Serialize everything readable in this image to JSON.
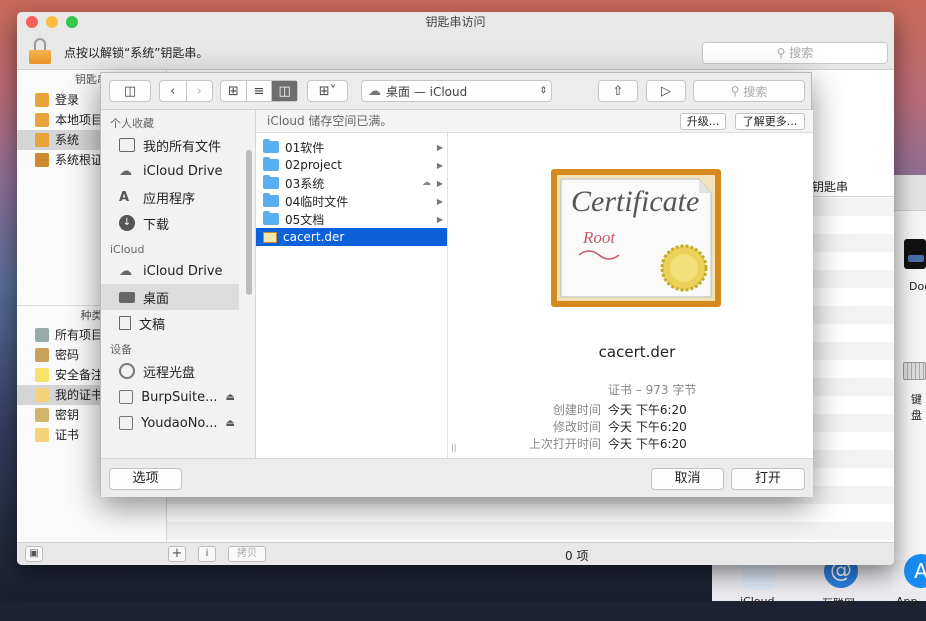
{
  "keychain": {
    "title": "钥匙串访问",
    "lock_text": "点按以解锁“系统”钥匙串。",
    "search_placeholder": "搜索",
    "section_keychains": "钥匙串",
    "keychains": [
      {
        "label": "登录"
      },
      {
        "label": "本地项目"
      },
      {
        "label": "系统"
      },
      {
        "label": "系统根证书"
      }
    ],
    "section_category": "种类",
    "categories": [
      {
        "label": "所有项目"
      },
      {
        "label": "密码"
      },
      {
        "label": "安全备注"
      },
      {
        "label": "我的证书"
      },
      {
        "label": "密钥"
      },
      {
        "label": "证书"
      }
    ],
    "column_keychain": "钥匙串",
    "bottom": {
      "add": "+",
      "info": "i",
      "copy": "拷贝",
      "count": "0 项"
    }
  },
  "bg_panel": {
    "dock_label": "Doc",
    "keyboard_label": "键盘",
    "dock_app1": "iCloud",
    "dock_app2": "互联网",
    "dock_app3": "App S"
  },
  "dialog": {
    "location": "桌面 — iCloud",
    "search_placeholder": "搜索",
    "sidebar": {
      "favorites_head": "个人收藏",
      "favorites": [
        {
          "label": "我的所有文件",
          "icon": "all-files-icon"
        },
        {
          "label": "iCloud Drive",
          "icon": "cloud-icon"
        },
        {
          "label": "应用程序",
          "icon": "applications-icon"
        },
        {
          "label": "下载",
          "icon": "download-icon"
        }
      ],
      "icloud_head": "iCloud",
      "icloud": [
        {
          "label": "iCloud Drive",
          "icon": "cloud-icon"
        },
        {
          "label": "桌面",
          "icon": "desktop-icon"
        },
        {
          "label": "文稿",
          "icon": "documents-icon"
        }
      ],
      "devices_head": "设备",
      "devices": [
        {
          "label": "远程光盘",
          "icon": "disc-icon"
        },
        {
          "label": "BurpSuite...",
          "icon": "drive-icon",
          "eject": "⏏"
        },
        {
          "label": "YoudaoNo...",
          "icon": "drive-icon",
          "eject": "⏏"
        }
      ]
    },
    "banner": {
      "text": "iCloud 储存空间已满。",
      "upgrade": "升级...",
      "learn_more": "了解更多..."
    },
    "files": [
      {
        "name": "01软件",
        "type": "folder"
      },
      {
        "name": "02project",
        "type": "folder"
      },
      {
        "name": "03系统",
        "type": "folder",
        "cloud": true
      },
      {
        "name": "04临时文件",
        "type": "folder"
      },
      {
        "name": "05文档",
        "type": "folder"
      },
      {
        "name": "cacert.der",
        "type": "cert",
        "selected": true
      }
    ],
    "preview": {
      "cert_title": "Certificate",
      "cert_sub": "Root",
      "filename": "cacert.der",
      "kind": "证书 – 973 字节",
      "created_label": "创建时间",
      "created_value": "今天 下午6:20",
      "modified_label": "修改时间",
      "modified_value": "今天 下午6:20",
      "opened_label": "上次打开时间",
      "opened_value": "今天 下午6:20"
    },
    "footer": {
      "options": "选项",
      "cancel": "取消",
      "open": "打开"
    }
  },
  "colors": {
    "selection": "#0b61d9",
    "folder": "#5aaef0",
    "lock": "#f0a33e",
    "light_red": "#fc605c",
    "light_yellow": "#fdbc40",
    "light_green": "#34c84a"
  }
}
